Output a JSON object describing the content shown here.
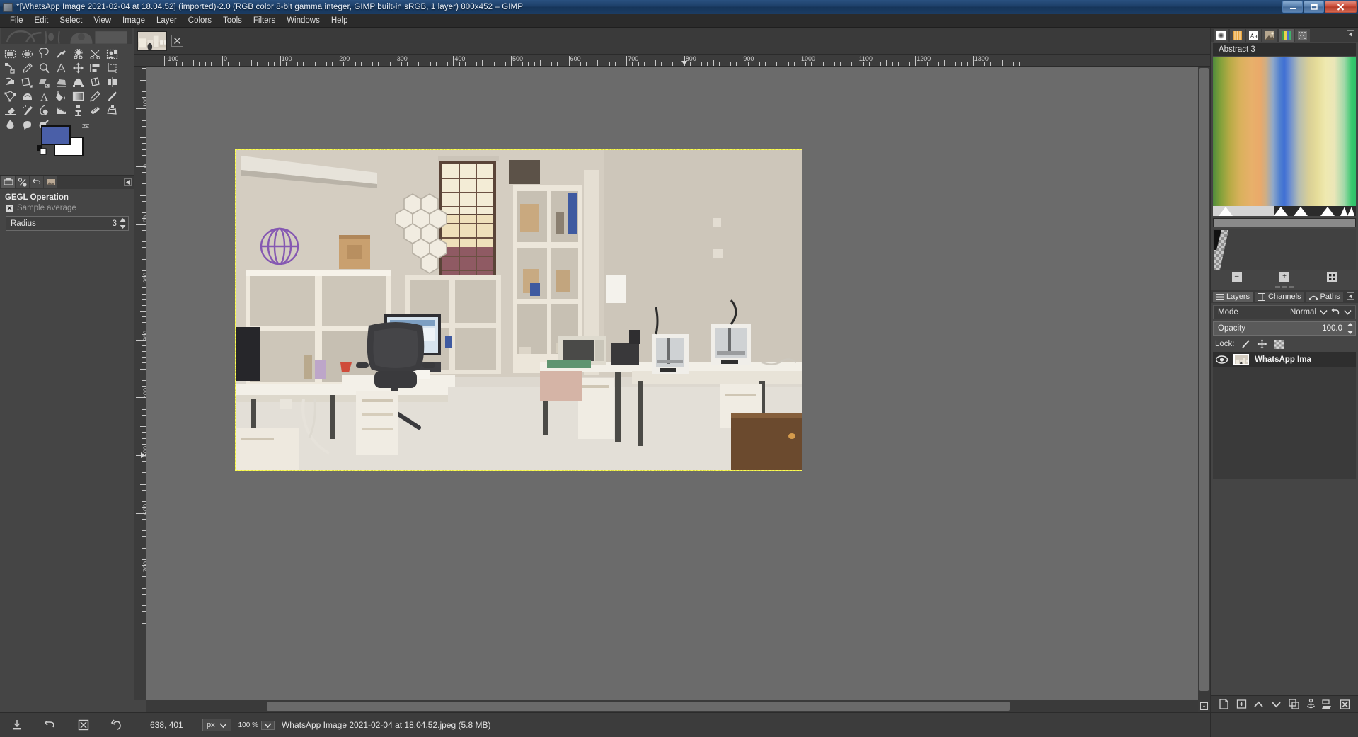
{
  "window": {
    "title": "*[WhatsApp Image 2021-02-04 at 18.04.52] (imported)-2.0 (RGB color 8-bit gamma integer, GIMP built-in sRGB, 1 layer) 800x452 – GIMP",
    "app_name": "GIMP",
    "minimize_label": "Minimize",
    "maximize_label": "Restore",
    "close_label": "Close"
  },
  "menubar": {
    "items": [
      {
        "label": "File"
      },
      {
        "label": "Edit"
      },
      {
        "label": "Select"
      },
      {
        "label": "View"
      },
      {
        "label": "Image"
      },
      {
        "label": "Layer"
      },
      {
        "label": "Colors"
      },
      {
        "label": "Tools"
      },
      {
        "label": "Filters"
      },
      {
        "label": "Windows"
      },
      {
        "label": "Help"
      }
    ]
  },
  "toolbox": {
    "tools": [
      "rectangle-select-tool",
      "ellipse-select-tool",
      "free-select-tool",
      "fuzzy-select-tool",
      "select-by-color-tool",
      "scissors-select-tool",
      "foreground-select-tool",
      "paths-tool",
      "color-picker-tool",
      "zoom-tool",
      "measure-tool",
      "move-tool",
      "alignment-tool",
      "crop-tool",
      "rotate-tool",
      "scale-tool",
      "shear-tool",
      "perspective-tool",
      "unified-transform-tool",
      "handle-transform-tool",
      "flip-tool",
      "cage-transform-tool",
      "warp-transform-tool",
      "text-tool",
      "bucket-fill-tool",
      "gradient-tool",
      "pencil-tool",
      "paintbrush-tool",
      "eraser-tool",
      "airbrush-tool",
      "ink-tool",
      "mypaint-brush-tool",
      "clone-tool",
      "heal-tool",
      "perspective-clone-tool",
      "blur-sharpen-tool",
      "smudge-tool",
      "dodge-burn-tool"
    ],
    "foreground_color": "#4a5fa8",
    "background_color": "#ffffff"
  },
  "tool_options": {
    "tab_icons": [
      "tool-options-tab",
      "device-status-tab",
      "undo-history-tab",
      "images-tab"
    ],
    "title": "GEGL Operation",
    "operation_label": "Sample average",
    "operation_checked": true,
    "radius": {
      "label": "Radius",
      "value": "3"
    }
  },
  "image_window": {
    "tab_title": "WhatsApp Image 2021-02-04 at 18.04.52.jpeg",
    "close_tab_label": "Close tab",
    "zoom_level": "100 %",
    "unit": "px"
  },
  "rulers": {
    "horizontal_ticks": [
      "-100",
      "0",
      "100",
      "200",
      "300",
      "400",
      "500",
      "600",
      "700",
      "800",
      "900",
      "1000",
      "1100",
      "1200",
      "1300"
    ],
    "vertical_ticks": [
      "-200",
      "-100",
      "0",
      "100",
      "200",
      "300",
      "400",
      "500",
      "600",
      "700"
    ],
    "pointer_marker_h": "800",
    "pointer_marker_v": "500"
  },
  "dock": {
    "tabs": [
      "brushes-tab",
      "patterns-tab",
      "fonts-tab",
      "document-history-tab",
      "gradients-tab",
      "palettes-tab"
    ],
    "active_tab": "gradients-tab",
    "gradient_name": "Abstract 3",
    "gradient_buttons": [
      "zoom-out-button",
      "zoom-in-button",
      "zoom-fit-button"
    ]
  },
  "layers_panel": {
    "tabs": [
      {
        "label": "Layers",
        "icon": "layers-icon",
        "active": true
      },
      {
        "label": "Channels",
        "icon": "channels-icon",
        "active": false
      },
      {
        "label": "Paths",
        "icon": "paths-icon",
        "active": false
      }
    ],
    "mode": {
      "label": "Mode",
      "value": "Normal"
    },
    "opacity": {
      "label": "Opacity",
      "value": "100.0"
    },
    "lock": {
      "label": "Lock:",
      "options": [
        "lock-pixels-icon",
        "lock-position-icon",
        "lock-alpha-icon"
      ]
    },
    "layers": [
      {
        "name": "WhatsApp Ima",
        "visible": true
      }
    ],
    "buttons": [
      "new-layer-button",
      "new-layer-group-button",
      "raise-layer-button",
      "lower-layer-button",
      "duplicate-layer-button",
      "anchor-layer-button",
      "merge-down-button",
      "delete-layer-button"
    ]
  },
  "statusbar": {
    "left_buttons": [
      "save-tool-preset-icon",
      "restore-tool-preset-icon",
      "delete-tool-preset-icon",
      "reset-tool-options-icon"
    ],
    "position": "638, 401",
    "unit": "px",
    "zoom": "100 %",
    "file_info": "WhatsApp Image 2021-02-04 at 18.04.52.jpeg (5.8 MB)"
  },
  "colors": {
    "titlebar_start": "#2a5180",
    "titlebar_end": "#16355a",
    "panel_bg": "#454545",
    "canvas_bg": "#6b6b6b",
    "selection_outline": "#fdfd55",
    "accent_blue": "#4a5fa8"
  }
}
